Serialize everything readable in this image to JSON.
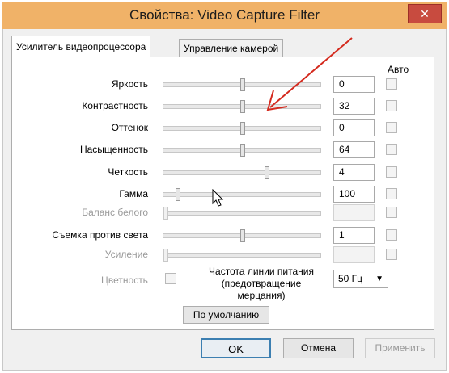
{
  "window": {
    "title": "Свойства: Video Capture Filter",
    "close_label": "✕"
  },
  "tabs": [
    {
      "label": "Усилитель видеопроцессора",
      "active": true
    },
    {
      "label": "Управление камерой",
      "active": false
    }
  ],
  "auto_header": "Авто",
  "properties": [
    {
      "label": "Яркость",
      "value": "0",
      "enabled": true,
      "slider_fraction": 0.5
    },
    {
      "label": "Контрастность",
      "value": "32",
      "enabled": true,
      "slider_fraction": 0.5
    },
    {
      "label": "Оттенок",
      "value": "0",
      "enabled": true,
      "slider_fraction": 0.5
    },
    {
      "label": "Насыщенность",
      "value": "64",
      "enabled": true,
      "slider_fraction": 0.5
    },
    {
      "label": "Четкость",
      "value": "4",
      "enabled": true,
      "slider_fraction": 0.66
    },
    {
      "label": "Гамма",
      "value": "100",
      "enabled": true,
      "slider_fraction": 0.08
    },
    {
      "label": "Баланс белого",
      "value": "",
      "enabled": false,
      "slider_fraction": 0.0
    },
    {
      "label": "Съемка против света",
      "value": "1",
      "enabled": true,
      "slider_fraction": 0.5
    },
    {
      "label": "Усиление",
      "value": "",
      "enabled": false,
      "slider_fraction": 0.0
    }
  ],
  "color_label": "Цветность",
  "powerline": {
    "label_line1": "Частота линии питания",
    "label_line2": "(предотвращение",
    "label_line3": "мерцания)",
    "selected": "50 Гц"
  },
  "buttons": {
    "default": "По умолчанию",
    "ok": "OK",
    "cancel": "Отмена",
    "apply": "Применить"
  },
  "colors": {
    "titlebar": "#f0b268",
    "annotation_arrow": "#d42a1e"
  }
}
